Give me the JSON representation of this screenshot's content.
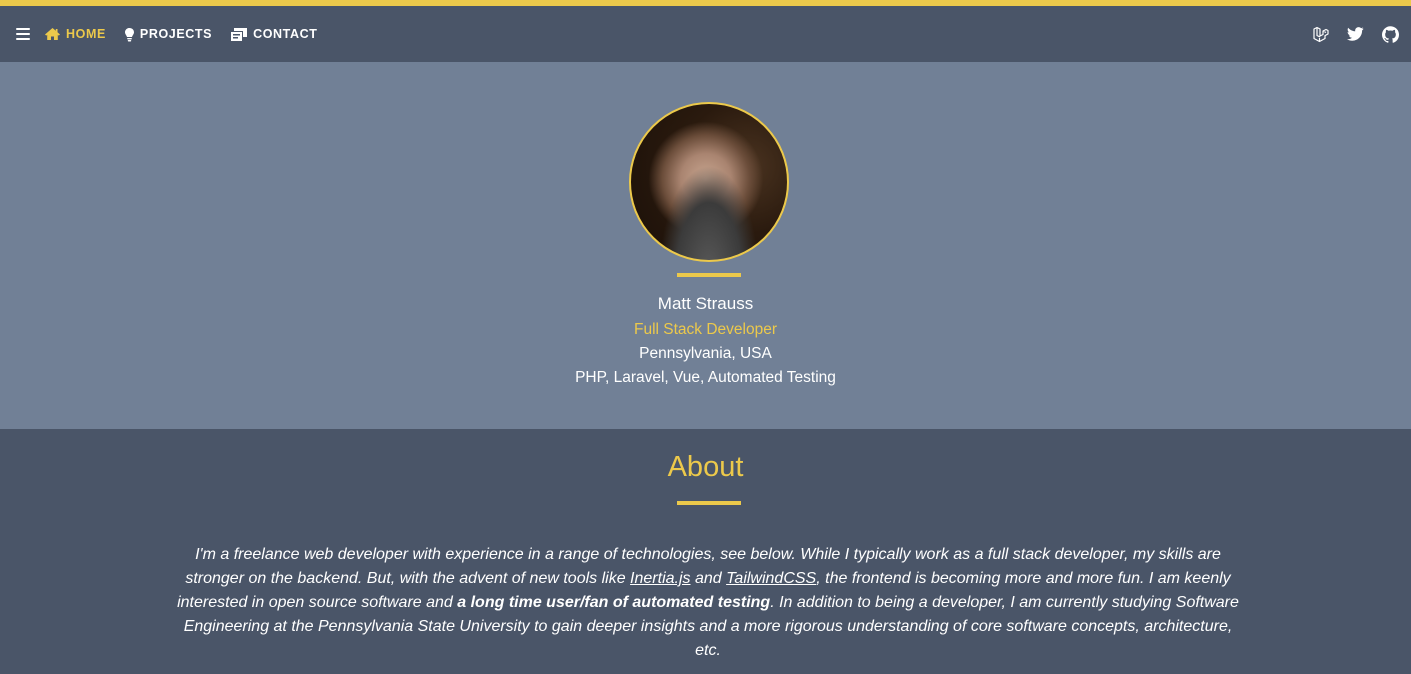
{
  "nav": {
    "items": [
      {
        "label": "HOME",
        "icon": "home-icon",
        "active": true
      },
      {
        "label": "PROJECTS",
        "icon": "lightbulb-icon",
        "active": false
      },
      {
        "label": "CONTACT",
        "icon": "mailbox-icon",
        "active": false
      }
    ],
    "social": [
      "laravel-icon",
      "twitter-icon",
      "github-icon"
    ]
  },
  "hero": {
    "name": "Matt Strauss",
    "role": "Full Stack Developer",
    "location": "Pennsylvania, USA",
    "skills": "PHP, Laravel, Vue, Automated Testing"
  },
  "about": {
    "title": "About",
    "p1": "I'm a freelance web developer with experience in a range of technologies, see below. While I typically work as a full stack developer, my skills are stronger on the backend. But, with the advent of new tools like ",
    "link1": "Inertia.js",
    "p2": " and ",
    "link2": "TailwindCSS",
    "p3": ", the frontend is becoming more and more fun. I am keenly interested in open source software and ",
    "bold": "a long time user/fan of automated testing",
    "p4": ". In addition to being a developer, I am currently studying Software Engineering at the Pennsylvania State University to gain deeper insights and a more rigorous understanding of core software concepts, architecture, etc."
  },
  "colors": {
    "accent": "#ecc94b",
    "nav_bg": "#4a5568",
    "hero_bg": "#718096"
  }
}
